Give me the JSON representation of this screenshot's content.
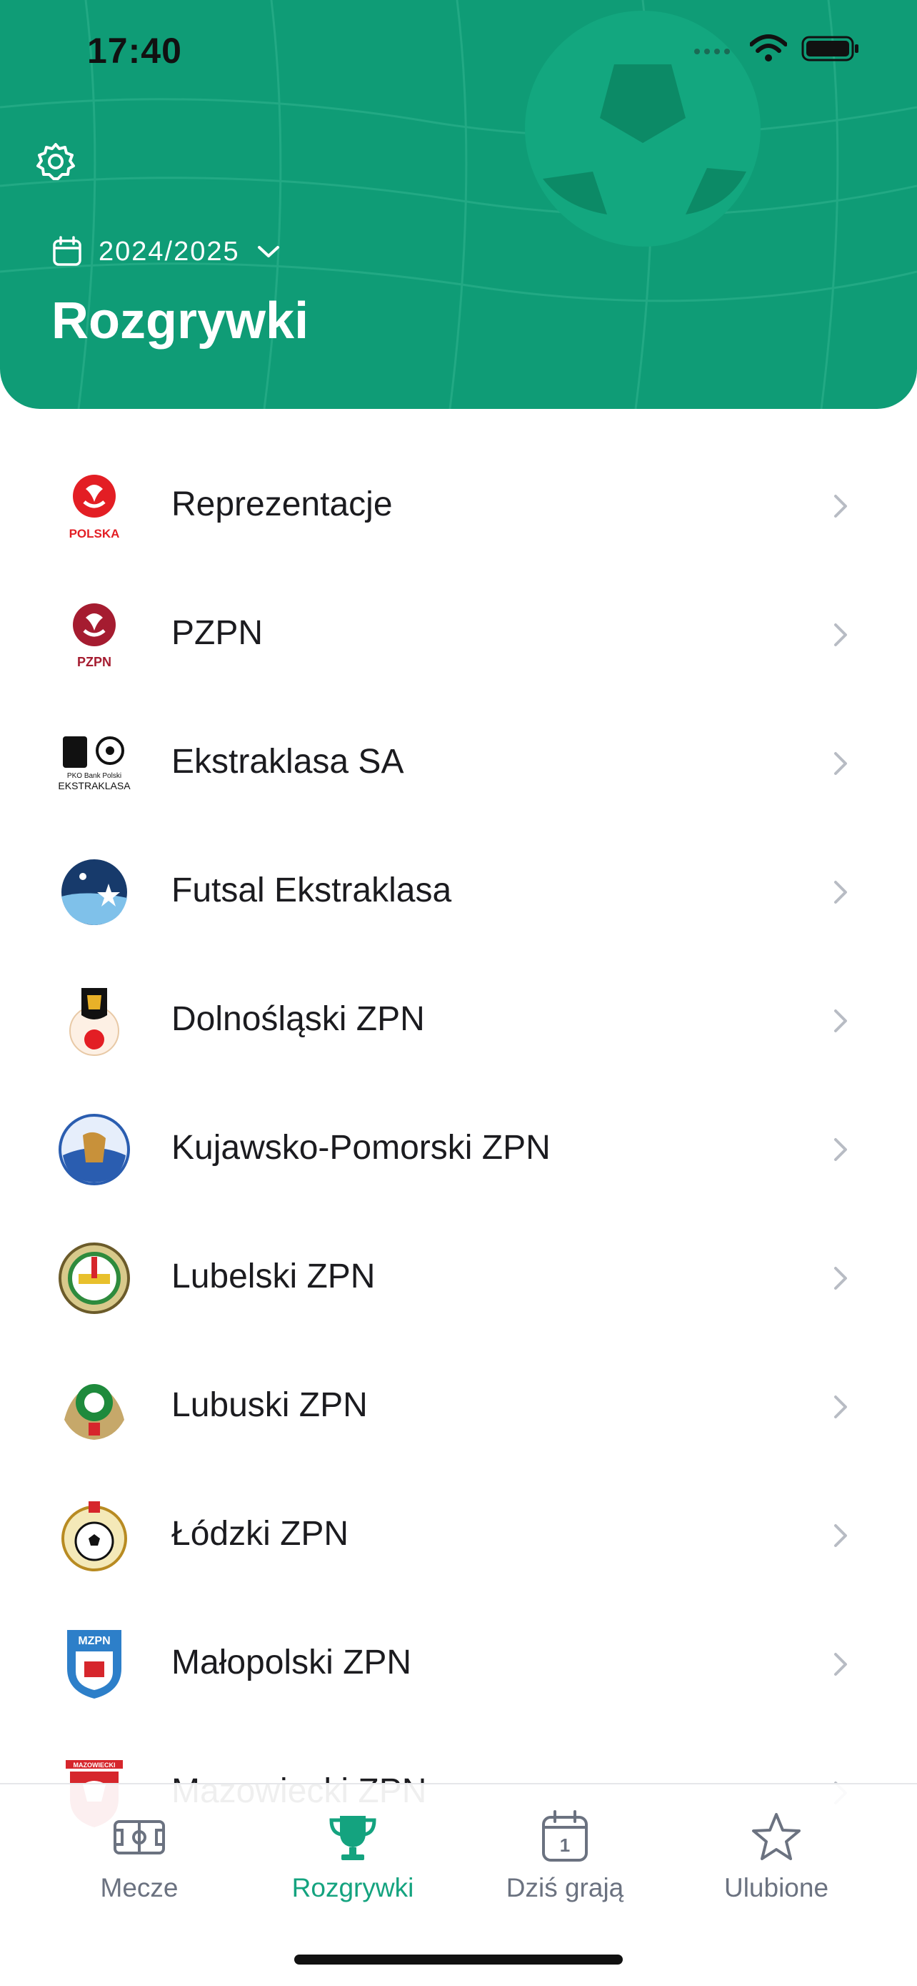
{
  "status_bar": {
    "time": "17:40"
  },
  "header": {
    "season": "2024/2025",
    "title": "Rozgrywki",
    "color": "#0f9c76"
  },
  "list": [
    {
      "label": "Reprezentacje",
      "icon": "polska-logo"
    },
    {
      "label": "PZPN",
      "icon": "pzpn-logo"
    },
    {
      "label": "Ekstraklasa SA",
      "icon": "ekstraklasa-logo"
    },
    {
      "label": "Futsal Ekstraklasa",
      "icon": "futsal-logo"
    },
    {
      "label": "Dolnośląski ZPN",
      "icon": "dolnoslaski-logo"
    },
    {
      "label": "Kujawsko-Pomorski ZPN",
      "icon": "kujawsko-pomorski-logo"
    },
    {
      "label": "Lubelski ZPN",
      "icon": "lubelski-logo"
    },
    {
      "label": "Lubuski ZPN",
      "icon": "lubuski-logo"
    },
    {
      "label": "Łódzki ZPN",
      "icon": "lodzki-logo"
    },
    {
      "label": "Małopolski ZPN",
      "icon": "malopolski-logo"
    },
    {
      "label": "Mazowiecki ZPN",
      "icon": "mazowiecki-logo"
    }
  ],
  "logo_text": {
    "polska": "POLSKA",
    "pzpn": "PZPN",
    "ekstraklasa_top": "PKO Bank Polski",
    "ekstraklasa_bottom": "EKSTRAKLASA",
    "mzpn": "MZPN",
    "mazowiecki": "MAZOWIECKI"
  },
  "tabs": [
    {
      "label": "Mecze",
      "icon": "pitch-icon",
      "active": false
    },
    {
      "label": "Rozgrywki",
      "icon": "trophy-icon",
      "active": true
    },
    {
      "label": "Dziś grają",
      "icon": "calendar-icon",
      "active": false,
      "badge": "1"
    },
    {
      "label": "Ulubione",
      "icon": "star-icon",
      "active": false
    }
  ],
  "colors": {
    "accent": "#14a37f",
    "inactive": "#6b7280",
    "chevron": "#b8bcc4"
  }
}
